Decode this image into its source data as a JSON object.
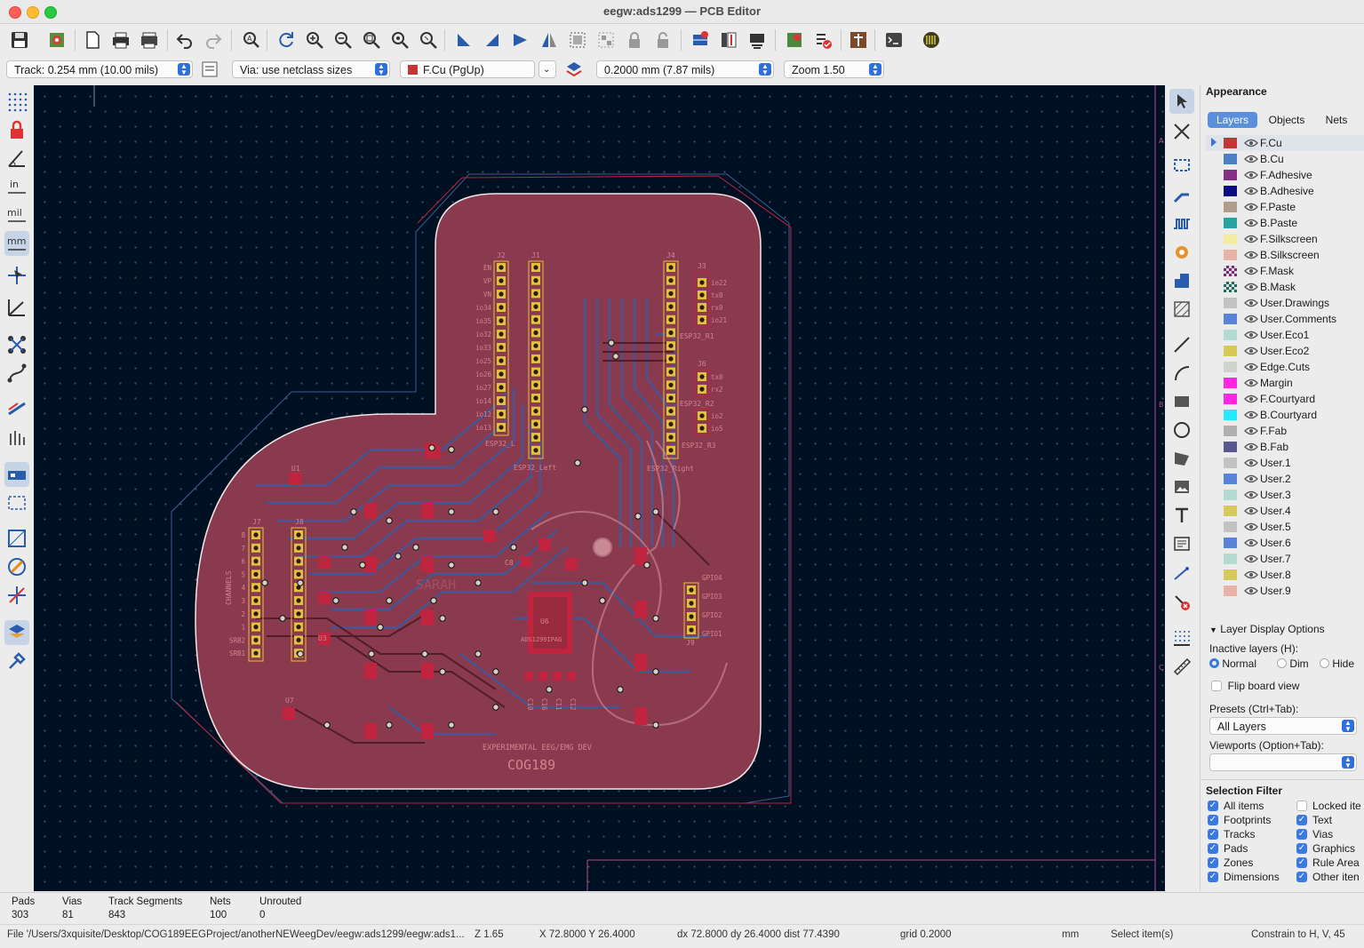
{
  "window": {
    "title": "eegw:ads1299 — PCB Editor"
  },
  "options_bar": {
    "track": "Track: 0.254 mm (10.00 mils)",
    "via": "Via: use netclass sizes",
    "layer": "F.Cu (PgUp)",
    "grid": "0.2000 mm (7.87 mils)",
    "zoom": "Zoom 1.50"
  },
  "left_tools": {
    "in_label": "in",
    "mil_label": "mil",
    "mm_label": "mm"
  },
  "board": {
    "silk_top": "EXPERIMENTAL EEG/EMG DEV",
    "silk_main": "COG189",
    "silk_ghost": "SARAH",
    "refs": {
      "J1": "J1",
      "J2": "J2",
      "J3": "J3",
      "J4": "J4",
      "J6": "J6",
      "J7": "J7",
      "J8": "J8",
      "J9": "J9",
      "U1": "U1",
      "U3": "U3",
      "U7": "U7",
      "U6": "U6",
      "C8": "C8"
    },
    "j2_pins": [
      "EN",
      "VP",
      "VN",
      "io34",
      "io35",
      "io32",
      "io33",
      "io25",
      "io26",
      "io27",
      "io14",
      "io12",
      "io13"
    ],
    "j3_pins": [
      "io22",
      "tx0",
      "rx0",
      "io21"
    ],
    "j6_pins": [
      "tx0",
      "rx2"
    ],
    "j6b_pins": [
      "io2",
      "io5"
    ],
    "j7_pins": [
      "8",
      "7",
      "6",
      "5",
      "4",
      "3",
      "2",
      "1",
      "SRB2",
      "SRB1"
    ],
    "j9_pins": [
      "GPIO4",
      "GPIO3",
      "GPIO2",
      "GPIO1"
    ],
    "labels": {
      "esp_l": "ESP32_L",
      "esp_left": "ESP32_Left",
      "esp_r1": "ESP32_R1",
      "esp_r2": "ESP32_R2",
      "esp_r3": "ESP32_R3",
      "esp_right": "ESP32_Right",
      "channels": "CHANNELS",
      "ads": "ADS1299IPAG",
      "c_labels": [
        "C10",
        "C16",
        "C11",
        "C12"
      ],
      "margin_a": "A",
      "margin_b": "B",
      "margin_c": "C"
    }
  },
  "appearance": {
    "title": "Appearance",
    "tabs": [
      "Layers",
      "Objects",
      "Nets"
    ],
    "layers": [
      {
        "name": "F.Cu",
        "color": "#c83434"
      },
      {
        "name": "B.Cu",
        "color": "#4d7fc4"
      },
      {
        "name": "F.Adhesive",
        "color": "#842f84"
      },
      {
        "name": "B.Adhesive",
        "color": "#0b0b84"
      },
      {
        "name": "F.Paste",
        "color": "#b09c8a"
      },
      {
        "name": "B.Paste",
        "color": "#2aa39e"
      },
      {
        "name": "F.Silkscreen",
        "color": "#f2eda1"
      },
      {
        "name": "B.Silkscreen",
        "color": "#e8b2a7"
      },
      {
        "name": "F.Mask",
        "color": "#7b2a7a"
      },
      {
        "name": "B.Mask",
        "color": "#1d6d5f"
      },
      {
        "name": "User.Drawings",
        "color": "#c2c2c2"
      },
      {
        "name": "User.Comments",
        "color": "#5983d6"
      },
      {
        "name": "User.Eco1",
        "color": "#b4dbd2"
      },
      {
        "name": "User.Eco2",
        "color": "#d6c85a"
      },
      {
        "name": "Edge.Cuts",
        "color": "#d0d2cd"
      },
      {
        "name": "Margin",
        "color": "#ff26e2"
      },
      {
        "name": "F.Courtyard",
        "color": "#ff26e2"
      },
      {
        "name": "B.Courtyard",
        "color": "#26e9ff"
      },
      {
        "name": "F.Fab",
        "color": "#afafaf"
      },
      {
        "name": "B.Fab",
        "color": "#58588f"
      },
      {
        "name": "User.1",
        "color": "#c2c2c2"
      },
      {
        "name": "User.2",
        "color": "#5983d6"
      },
      {
        "name": "User.3",
        "color": "#b4dbd2"
      },
      {
        "name": "User.4",
        "color": "#d6c85a"
      },
      {
        "name": "User.5",
        "color": "#c2c2c2"
      },
      {
        "name": "User.6",
        "color": "#5983d6"
      },
      {
        "name": "User.7",
        "color": "#b4dbd2"
      },
      {
        "name": "User.8",
        "color": "#d6c85a"
      },
      {
        "name": "User.9",
        "color": "#e8b2a7"
      }
    ],
    "display_options": "Layer Display Options",
    "inactive_label": "Inactive layers (H):",
    "inactive_options": [
      "Normal",
      "Dim",
      "Hide"
    ],
    "flip": "Flip board view",
    "presets_label": "Presets (Ctrl+Tab):",
    "presets_value": "All Layers",
    "viewports_label": "Viewports (Option+Tab):",
    "viewports_value": ""
  },
  "selection_filter": {
    "title": "Selection Filter",
    "left": [
      {
        "label": "All items",
        "checked": true
      },
      {
        "label": "Footprints",
        "checked": true
      },
      {
        "label": "Tracks",
        "checked": true
      },
      {
        "label": "Pads",
        "checked": true
      },
      {
        "label": "Zones",
        "checked": true
      },
      {
        "label": "Dimensions",
        "checked": true
      }
    ],
    "right": [
      {
        "label": "Locked ite",
        "checked": false
      },
      {
        "label": "Text",
        "checked": true
      },
      {
        "label": "Vias",
        "checked": true
      },
      {
        "label": "Graphics",
        "checked": true
      },
      {
        "label": "Rule Area",
        "checked": true
      },
      {
        "label": "Other iten",
        "checked": true
      }
    ]
  },
  "stats": [
    {
      "label": "Pads",
      "value": "303"
    },
    {
      "label": "Vias",
      "value": "81"
    },
    {
      "label": "Track Segments",
      "value": "843"
    },
    {
      "label": "Nets",
      "value": "100"
    },
    {
      "label": "Unrouted",
      "value": "0"
    }
  ],
  "status": {
    "file": "File '/Users/3xquisite/Desktop/COG189EEGProject/anotherNEWeegDev/eegw:ads1299/eegw:ads1...",
    "zoom": "Z 1.65",
    "xy": "X 72.8000  Y 26.4000",
    "delta": "dx 72.8000  dy 26.4000  dist 77.4390",
    "grid": "grid 0.2000",
    "units": "mm",
    "mode": "Select item(s)",
    "constrain": "Constrain to H, V, 45"
  }
}
